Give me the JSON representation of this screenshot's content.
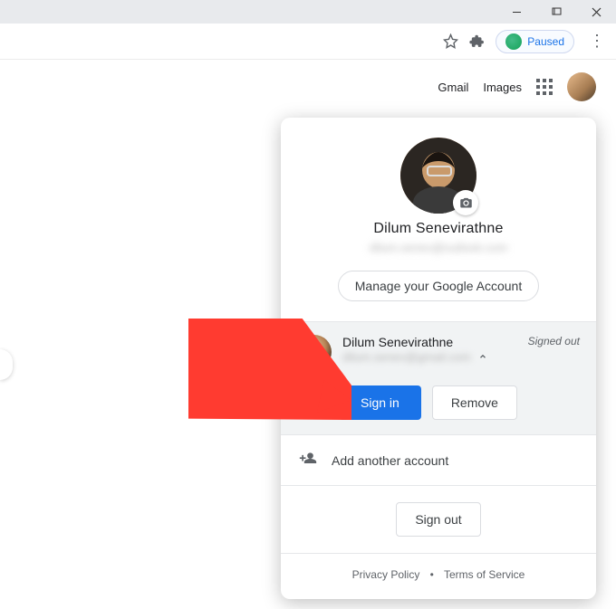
{
  "toolbar": {
    "paused_label": "Paused"
  },
  "nav": {
    "gmail": "Gmail",
    "images": "Images"
  },
  "panel": {
    "name": "Dilum Senevirathne",
    "email_blur": "dilum.senev@outlook.com",
    "manage_label": "Manage your Google Account",
    "account_row": {
      "name": "Dilum Senevirathne",
      "email_blur": "dilum.senev@gmail.com",
      "status": "Signed out",
      "sign_in": "Sign in",
      "remove": "Remove"
    },
    "add_account": "Add another account",
    "sign_out": "Sign out",
    "footer": {
      "privacy": "Privacy Policy",
      "terms": "Terms of Service"
    }
  }
}
